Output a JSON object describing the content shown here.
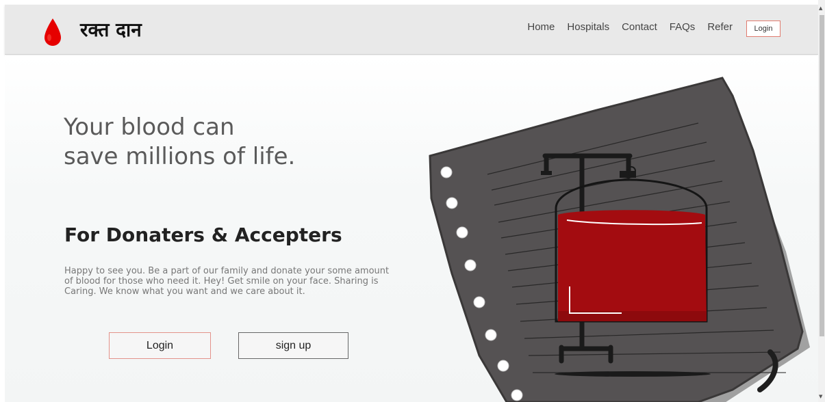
{
  "brand": {
    "name": "रक्त दान",
    "accent": "#e60000"
  },
  "nav": {
    "links": [
      "Home",
      "Hospitals",
      "Contact",
      "FAQs",
      "Refer"
    ],
    "login": "Login"
  },
  "hero": {
    "headline_line1": "Your blood can",
    "headline_line2": "save millions of life.",
    "subhead": "For Donaters & Accepters",
    "paragraph": "Happy to see you. Be a part of our family and donate your some amount of blood for those who need it. Hey! Get smile on your face. Sharing is Caring. We know what you want and we care about it.",
    "login_button": "Login",
    "signup_button": "sign up"
  },
  "icons": {
    "logo": "blood-drop-icon",
    "illustration": "blood-bag-on-notepad",
    "scroll_up": "chevron-up-icon",
    "scroll_down": "chevron-down-icon"
  },
  "colors": {
    "blood": "#a30c10",
    "notepad": "#555253",
    "login_border": "#e07a6e"
  }
}
